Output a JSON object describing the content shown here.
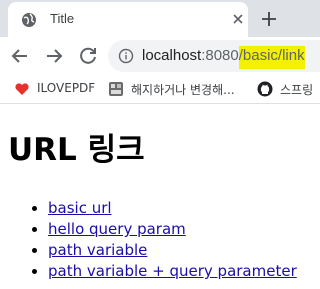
{
  "browser": {
    "tab": {
      "title": "Title"
    },
    "address_bar": {
      "host": "localhost",
      "port": ":8080",
      "path": "/basic/link"
    },
    "bookmarks": [
      {
        "label": "ILOVEPDF",
        "icon": "heart-icon"
      },
      {
        "label": "해지하거나 변경해...",
        "icon": "bookmark-app-icon"
      },
      {
        "label": "스프링",
        "icon": "github-icon"
      }
    ]
  },
  "page": {
    "title": "URL 링크",
    "links": [
      {
        "label": "basic url"
      },
      {
        "label": "hello query param"
      },
      {
        "label": "path variable"
      },
      {
        "label": "path variable + query parameter"
      }
    ]
  },
  "colors": {
    "highlight": "#f3f000",
    "link": "#1a0dab",
    "tabstrip": "#dee1e6"
  }
}
